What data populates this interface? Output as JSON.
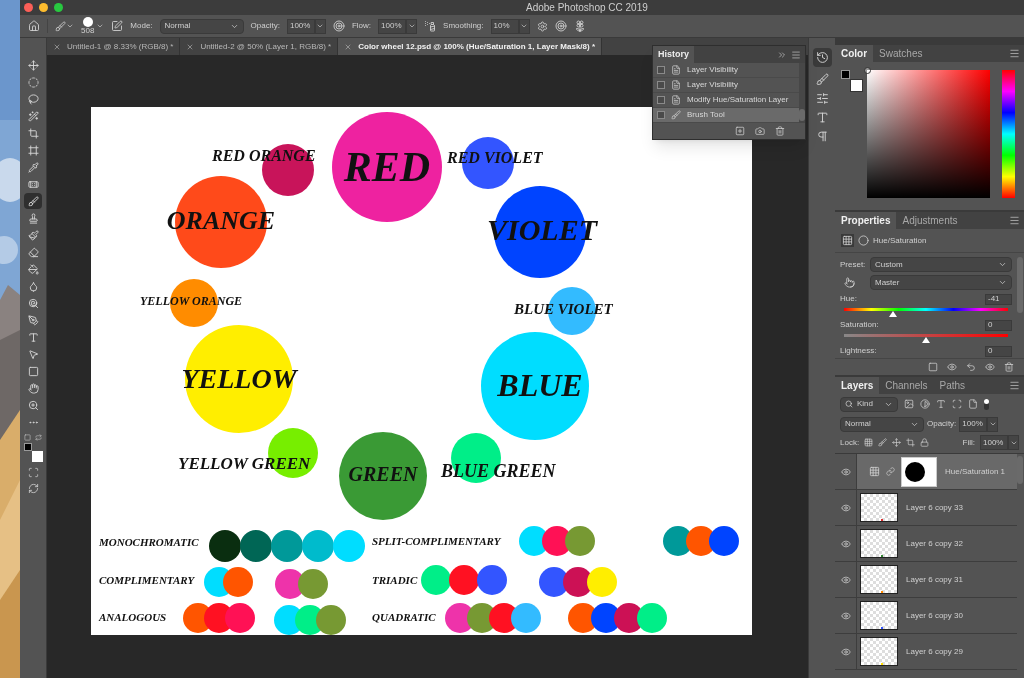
{
  "window": {
    "title": "Adobe Photoshop CC 2019"
  },
  "options_bar": {
    "brush_size": "508",
    "mode_label": "Mode:",
    "mode": "Normal",
    "opacity_label": "Opacity:",
    "opacity": "100%",
    "flow_label": "Flow:",
    "flow": "100%",
    "smoothing_label": "Smoothing:",
    "smoothing": "10%"
  },
  "tabs": [
    {
      "label": "Untitled-1 @ 8.33% (RGB/8) *",
      "selected": false
    },
    {
      "label": "Untitled-2 @ 50% (Layer 1, RGB/8) *",
      "selected": false
    },
    {
      "label": "Color wheel 12.psd @ 100% (Hue/Saturation 1, Layer Mask/8) *",
      "selected": true
    }
  ],
  "tools": [
    {
      "selected": false
    },
    {
      "selected": false
    },
    {
      "selected": false
    },
    {
      "selected": false
    },
    {
      "selected": false
    },
    {
      "selected": false
    },
    {
      "selected": false
    },
    {
      "selected": false
    },
    {
      "selected": true
    },
    {
      "selected": false
    },
    {
      "selected": false
    },
    {
      "selected": false
    },
    {
      "selected": false
    },
    {
      "selected": false
    },
    {
      "selected": false
    },
    {
      "selected": false
    },
    {
      "selected": false
    },
    {
      "selected": false
    },
    {
      "selected": false
    },
    {
      "selected": false
    },
    {
      "selected": false
    },
    {
      "selected": false
    }
  ],
  "canvas": {
    "wheel": [
      {
        "label": "RED ORANGE",
        "color": "#c8145a"
      },
      {
        "label": "RED",
        "color": "#ee22a0"
      },
      {
        "label": "RED VIOLET",
        "color": "#3355ff"
      },
      {
        "label": "ORANGE",
        "color": "#ff4a1a"
      },
      {
        "label": "VIOLET",
        "color": "#0044ff"
      },
      {
        "label": "YELLOW ORANGE",
        "color": "#ff8c00"
      },
      {
        "label": "BLUE VIOLET",
        "color": "#33bbff"
      },
      {
        "label": "YELLOW",
        "color": "#ffee00"
      },
      {
        "label": "BLUE",
        "color": "#00ddff"
      },
      {
        "label": "YELLOW GREEN",
        "color": "#77ee00"
      },
      {
        "label": "GREEN",
        "color": "#3a9a35"
      },
      {
        "label": "BLUE GREEN",
        "color": "#00ee88"
      }
    ],
    "schemes": [
      {
        "label": "MONOCHROMATIC",
        "groups": [
          {
            "swatches": [
              {
                "color": "#0a2e10"
              },
              {
                "color": "#006655"
              },
              {
                "color": "#009999"
              },
              {
                "color": "#00bbcc"
              },
              {
                "color": "#00ddff"
              }
            ]
          }
        ]
      },
      {
        "label": "SPLIT-COMPLIMENTARY",
        "groups": [
          {
            "swatches": [
              {
                "color": "#00ddff"
              },
              {
                "color": "#ff1155"
              },
              {
                "color": "#779933"
              }
            ]
          },
          {
            "swatches": [
              {
                "color": "#009999"
              },
              {
                "color": "#ff5500"
              },
              {
                "color": "#0044ff"
              }
            ]
          }
        ]
      },
      {
        "label": "COMPLIMENTARY",
        "groups": [
          {
            "swatches": [
              {
                "color": "#00ddff"
              },
              {
                "color": "#ff5500"
              }
            ]
          },
          {
            "swatches": [
              {
                "color": "#ee33aa"
              },
              {
                "color": "#779933"
              }
            ]
          }
        ]
      },
      {
        "label": "TRIADIC",
        "groups": [
          {
            "swatches": [
              {
                "color": "#00ee88"
              },
              {
                "color": "#ff1122"
              },
              {
                "color": "#3355ff"
              }
            ]
          },
          {
            "swatches": [
              {
                "color": "#3355ff"
              },
              {
                "color": "#cc1155"
              },
              {
                "color": "#ffee00"
              }
            ]
          }
        ]
      },
      {
        "label": "ANALOGOUS",
        "groups": [
          {
            "swatches": [
              {
                "color": "#ff5500"
              },
              {
                "color": "#ff1122"
              },
              {
                "color": "#ff1155"
              }
            ]
          },
          {
            "swatches": [
              {
                "color": "#00ddff"
              },
              {
                "color": "#00ee88"
              },
              {
                "color": "#779933"
              }
            ]
          }
        ]
      },
      {
        "label": "QUADRATIC",
        "groups": [
          {
            "swatches": [
              {
                "color": "#ee33aa"
              },
              {
                "color": "#779933"
              },
              {
                "color": "#ff1122"
              },
              {
                "color": "#33bbff"
              }
            ]
          },
          {
            "swatches": [
              {
                "color": "#ff5500"
              },
              {
                "color": "#0044ff"
              },
              {
                "color": "#cc1155"
              },
              {
                "color": "#00ee88"
              }
            ]
          }
        ]
      }
    ]
  },
  "history": {
    "title": "History",
    "items": [
      {
        "label": "Layer Visibility",
        "kind": "step",
        "selected": false
      },
      {
        "label": "Layer Visibility",
        "kind": "step",
        "selected": false
      },
      {
        "label": "Modify Hue/Saturation Layer",
        "kind": "step",
        "selected": false
      },
      {
        "label": "Brush Tool",
        "kind": "brush",
        "selected": true
      }
    ]
  },
  "color_panel": {
    "tabs": [
      {
        "label": "Color",
        "selected": true
      },
      {
        "label": "Swatches",
        "selected": false
      }
    ]
  },
  "properties": {
    "tabs": [
      {
        "label": "Properties",
        "selected": true
      },
      {
        "label": "Adjustments",
        "selected": false
      }
    ],
    "title": "Hue/Saturation",
    "preset_label": "Preset:",
    "preset": "Custom",
    "channel": "Master",
    "sliders": [
      {
        "label": "Hue:",
        "value": "-41",
        "kind": "hue",
        "level": 0.3
      },
      {
        "label": "Saturation:",
        "value": "0",
        "kind": "saturation",
        "level": 0.5
      },
      {
        "label": "Lightness:",
        "value": "0",
        "kind": "plain"
      }
    ]
  },
  "layers": {
    "tabs": [
      {
        "label": "Layers",
        "selected": true
      },
      {
        "label": "Channels",
        "selected": false
      },
      {
        "label": "Paths",
        "selected": false
      }
    ],
    "filter": "Kind",
    "blend_mode": "Normal",
    "opacity_label": "Opacity:",
    "opacity": "100%",
    "lock_label": "Lock:",
    "fill_label": "Fill:",
    "fill": "100%",
    "items": [
      {
        "name": "Hue/Saturation 1",
        "kind": "adjustment",
        "selected": true
      },
      {
        "name": "Layer 6 copy 33",
        "kind": "pixel",
        "selected": false,
        "color": "#e03030"
      },
      {
        "name": "Layer 6 copy 32",
        "kind": "pixel",
        "selected": false,
        "color": "#338833"
      },
      {
        "name": "Layer 6 copy 31",
        "kind": "pixel",
        "selected": false,
        "color": "#ff8800"
      },
      {
        "name": "Layer 6 copy 30",
        "kind": "pixel",
        "selected": false,
        "color": "#3355ff"
      },
      {
        "name": "Layer 6 copy 29",
        "kind": "pixel",
        "selected": false,
        "color": "#ffdd00"
      }
    ]
  }
}
